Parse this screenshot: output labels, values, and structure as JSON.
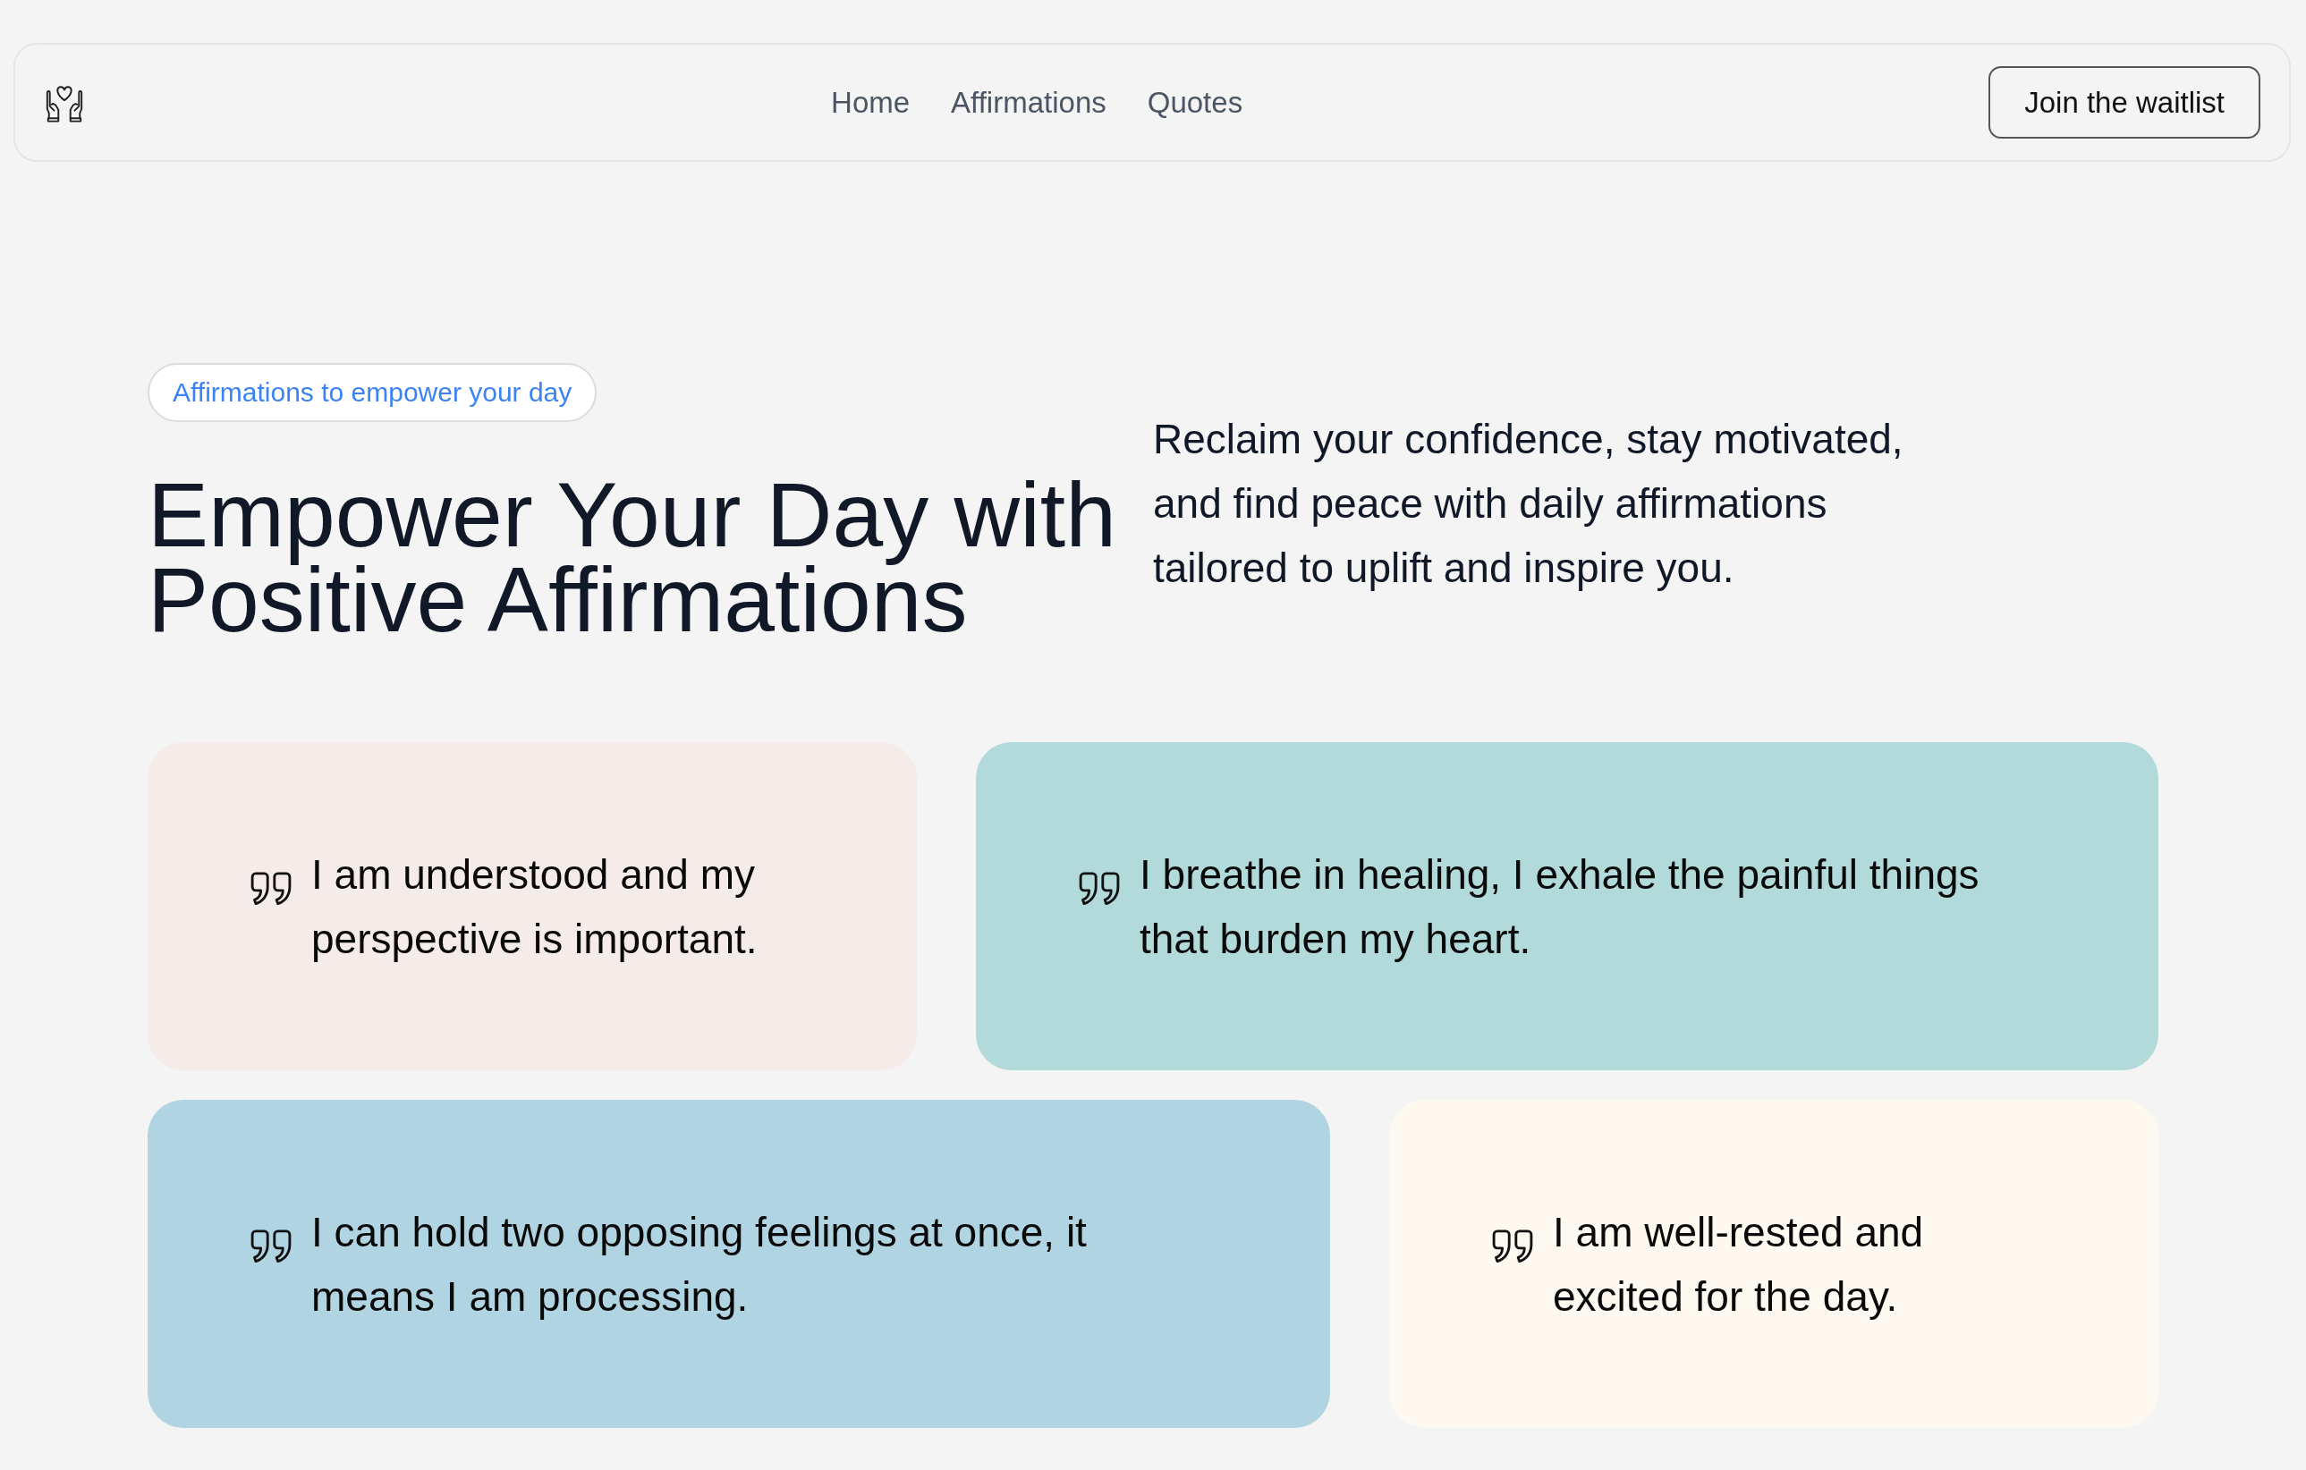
{
  "header": {
    "nav_links": [
      {
        "label": "Home"
      },
      {
        "label": "Affirmations"
      },
      {
        "label": "Quotes"
      }
    ],
    "cta_button": "Join the waitlist"
  },
  "hero": {
    "badge": "Affirmations to empower your day",
    "heading": "Empower Your Day with Positive Affirmations",
    "description": "Reclaim your confidence, stay motivated, and find peace with daily affirmations tailored to uplift and inspire you."
  },
  "affirmations": [
    {
      "text": "I am understood and my perspective is important.",
      "color": "#f5ebe9"
    },
    {
      "text": "I breathe in healing, I exhale the painful things that burden my heart.",
      "color": "#b2dadb"
    },
    {
      "text": "I can hold two opposing feelings at once, it means I am processing.",
      "color": "#b0d4e2"
    },
    {
      "text": "I am well-rested and excited for the day.",
      "color": "#fdf9f0"
    }
  ]
}
